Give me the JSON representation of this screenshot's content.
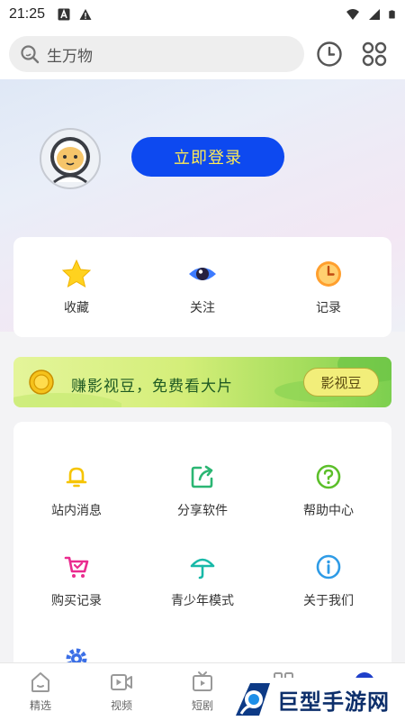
{
  "status_bar": {
    "time": "21:25",
    "icons": [
      "a-box-icon",
      "warning-icon",
      "wifi-icon",
      "signal-icon",
      "battery-icon"
    ]
  },
  "header": {
    "search_text": "生万物",
    "icons": [
      "search-icon",
      "history-clock-icon",
      "apps-grid-icon"
    ]
  },
  "profile": {
    "login_label": "立即登录",
    "avatar_icon": "astronaut-avatar-icon"
  },
  "quick_actions": [
    {
      "label": "收藏",
      "icon": "star-icon"
    },
    {
      "label": "关注",
      "icon": "eye-icon"
    },
    {
      "label": "记录",
      "icon": "clock-icon"
    }
  ],
  "banner": {
    "text": "赚影视豆，免费看大片",
    "button_label": "影视豆",
    "icon": "coin-icon"
  },
  "menu": [
    {
      "label": "站内消息",
      "icon": "bell-icon"
    },
    {
      "label": "分享软件",
      "icon": "share-icon"
    },
    {
      "label": "帮助中心",
      "icon": "help-icon"
    },
    {
      "label": "购买记录",
      "icon": "cart-icon"
    },
    {
      "label": "青少年模式",
      "icon": "umbrella-icon"
    },
    {
      "label": "关于我们",
      "icon": "info-icon"
    },
    {
      "label": "",
      "icon": "settings-gear-icon"
    }
  ],
  "bottom_nav": [
    {
      "label": "精选",
      "icon": "home-icon"
    },
    {
      "label": "视频",
      "icon": "video-icon"
    },
    {
      "label": "短剧",
      "icon": "tv-icon"
    }
  ],
  "watermark": {
    "text": "巨型手游网"
  },
  "colors": {
    "accent_blue": "#0d49f0",
    "login_text": "#ffeb55",
    "banner_green": "#a8de5e"
  }
}
